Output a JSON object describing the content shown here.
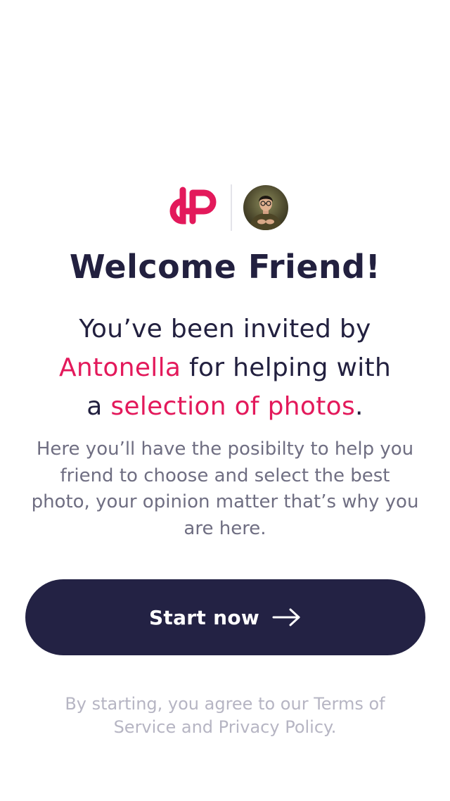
{
  "brand": {
    "logo_icon": "dp-logo-icon",
    "accent_color": "#e3195b",
    "avatar_icon": "inviter-avatar-photo"
  },
  "welcome": {
    "title": "Welcome Friend!"
  },
  "invite": {
    "line1": "You’ve been invited by",
    "inviter_name": "Antonella",
    "line2_rest": " for helping with",
    "line3_prefix": "a ",
    "selection_text": "selection of photos",
    "line3_suffix": "."
  },
  "description": {
    "text": "Here you’ll have the posibilty to help you friend to choose and select the best photo, your opinion matter that’s why you are here."
  },
  "cta": {
    "label": "Start now",
    "icon": "arrow-right-icon",
    "background": "#232244"
  },
  "legal": {
    "text": "By starting, you agree to our Terms of Service and Privacy Policy."
  }
}
